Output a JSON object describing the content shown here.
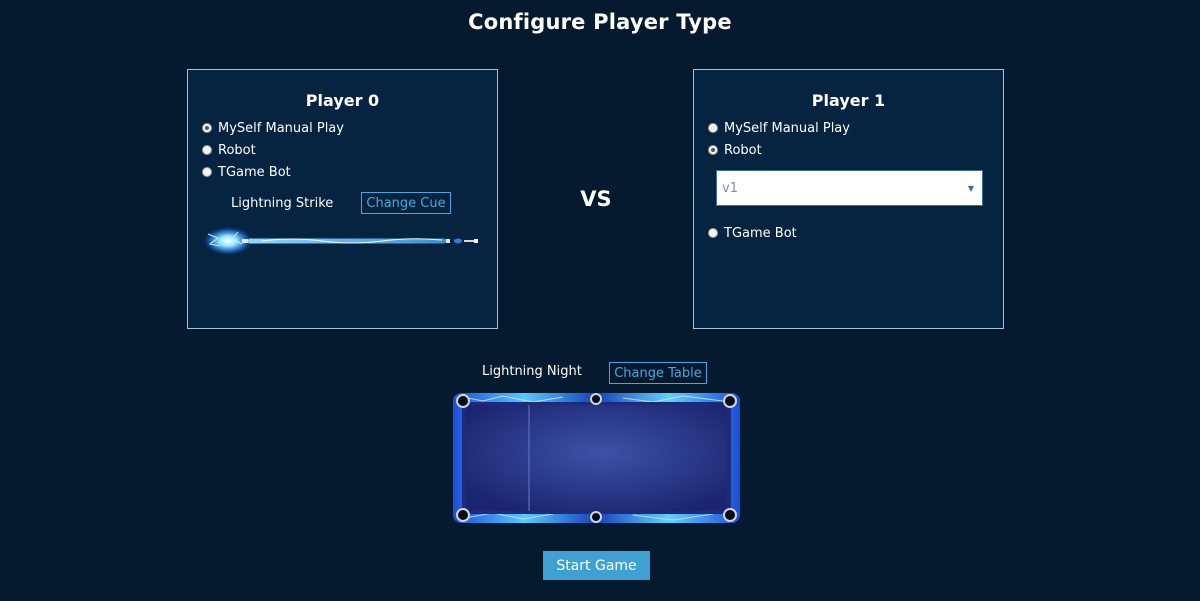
{
  "page": {
    "title": "Configure Player Type",
    "vs_label": "VS"
  },
  "player0": {
    "title": "Player 0",
    "options": [
      "MySelf Manual Play",
      "Robot",
      "TGame Bot"
    ],
    "selected": "MySelf Manual Play",
    "cue_name": "Lightning Strike",
    "change_cue_label": "Change Cue"
  },
  "player1": {
    "title": "Player 1",
    "options": [
      "MySelf Manual Play",
      "Robot",
      "TGame Bot"
    ],
    "selected": "Robot",
    "robot_version": "v1"
  },
  "table": {
    "name": "Lightning Night",
    "change_table_label": "Change Table"
  },
  "actions": {
    "start_label": "Start Game"
  },
  "colors": {
    "background": "#051a2e",
    "panel_bg": "#062340",
    "panel_border": "#9ec3dc",
    "accent": "#4aa7de",
    "start_button": "#3fa0d2"
  }
}
